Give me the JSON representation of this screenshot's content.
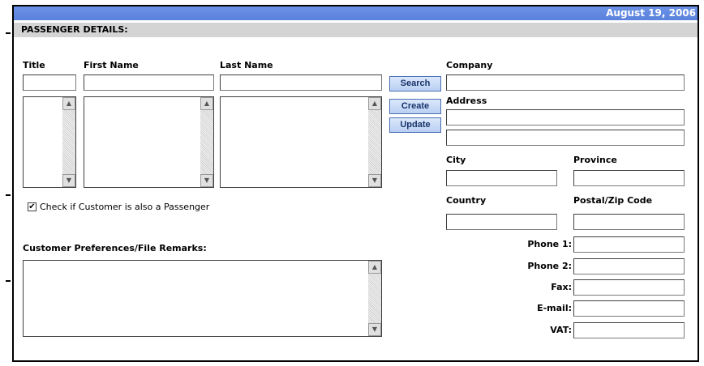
{
  "header": {
    "date": "August 19, 2006"
  },
  "section": {
    "title": "PASSENGER DETAILS:"
  },
  "passenger": {
    "title_label": "Title",
    "first_name_label": "First Name",
    "last_name_label": "Last Name",
    "title_value": "",
    "first_name_value": "",
    "last_name_value": ""
  },
  "buttons": {
    "search": "Search",
    "create": "Create",
    "update": "Update"
  },
  "company": {
    "company_label": "Company",
    "address_label": "Address",
    "city_label": "City",
    "province_label": "Province",
    "country_label": "Country",
    "postal_label": "Postal/Zip Code"
  },
  "contact": {
    "phone1_label": "Phone 1:",
    "phone2_label": "Phone 2:",
    "fax_label": "Fax:",
    "email_label": "E-mail:",
    "vat_label": "VAT:"
  },
  "checkbox": {
    "label": "Check if Customer is also a Passenger",
    "checked": true
  },
  "remarks": {
    "label": "Customer Preferences/File Remarks:",
    "value": ""
  },
  "icons": {
    "scroll_up": "scroll-up-arrow",
    "scroll_down": "scroll-down-arrow",
    "check": "checkmark"
  }
}
